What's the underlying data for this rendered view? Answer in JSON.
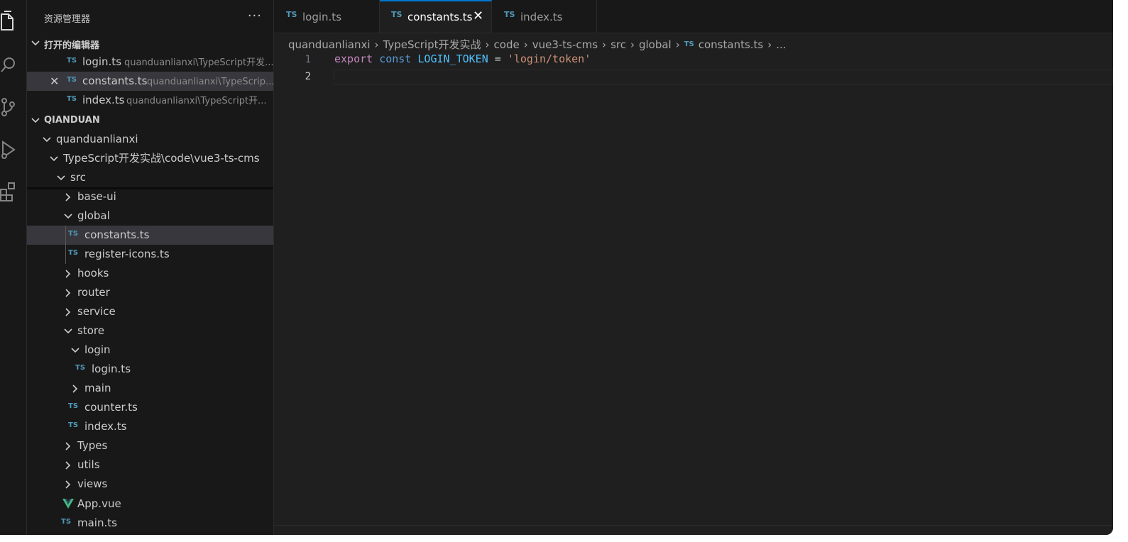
{
  "sidebar": {
    "title": "资源管理器",
    "more": "···",
    "open_editors": {
      "label": "打开的编辑器",
      "items": [
        {
          "badge": "TS",
          "name": "login.ts",
          "path": "quanduanlianxi\\TypeScript开发...",
          "active": false
        },
        {
          "badge": "TS",
          "name": "constants.ts",
          "path": "quanduanlianxi\\TypeScrip...",
          "active": true
        },
        {
          "badge": "TS",
          "name": "index.ts",
          "path": "quanduanlianxi\\TypeScript开..."
        }
      ]
    },
    "workspace": {
      "label": "QIANDUAN",
      "tree": [
        {
          "name": "quanduanlianxi"
        },
        {
          "name": "TypeScript开发实战\\code\\vue3-ts-cms"
        },
        {
          "name": "src"
        },
        {
          "name": "base-ui"
        },
        {
          "name": "global"
        },
        {
          "name": "constants.ts",
          "badge": "TS"
        },
        {
          "name": "register-icons.ts",
          "badge": "TS"
        },
        {
          "name": "hooks"
        },
        {
          "name": "router"
        },
        {
          "name": "service"
        },
        {
          "name": "store"
        },
        {
          "name": "login"
        },
        {
          "name": "login.ts",
          "badge": "TS"
        },
        {
          "name": "main"
        },
        {
          "name": "counter.ts",
          "badge": "TS"
        },
        {
          "name": "index.ts",
          "badge": "TS"
        },
        {
          "name": "Types"
        },
        {
          "name": "utils"
        },
        {
          "name": "views"
        },
        {
          "name": "App.vue",
          "badge": "V"
        },
        {
          "name": "main.ts",
          "badge": "TS"
        }
      ]
    }
  },
  "tabs": [
    {
      "badge": "TS",
      "name": "login.ts"
    },
    {
      "badge": "TS",
      "name": "constants.ts",
      "close": "✕"
    },
    {
      "badge": "TS",
      "name": "index.ts"
    }
  ],
  "breadcrumb": [
    "quanduanlianxi",
    "TypeScript开发实战",
    "code",
    "vue3-ts-cms",
    "src",
    "global",
    "constants.ts",
    "..."
  ],
  "breadcrumb_file_badge": "TS",
  "editor": {
    "line_numbers": [
      "1",
      "2"
    ],
    "line1": {
      "kw": "export",
      "kw2": "const",
      "name": "LOGIN_TOKEN",
      "op": "=",
      "str": "'login/token'"
    }
  },
  "colors": {
    "accent": "#0078d4",
    "ts_badge": "#519aba",
    "vue_badge": "#41b883"
  }
}
